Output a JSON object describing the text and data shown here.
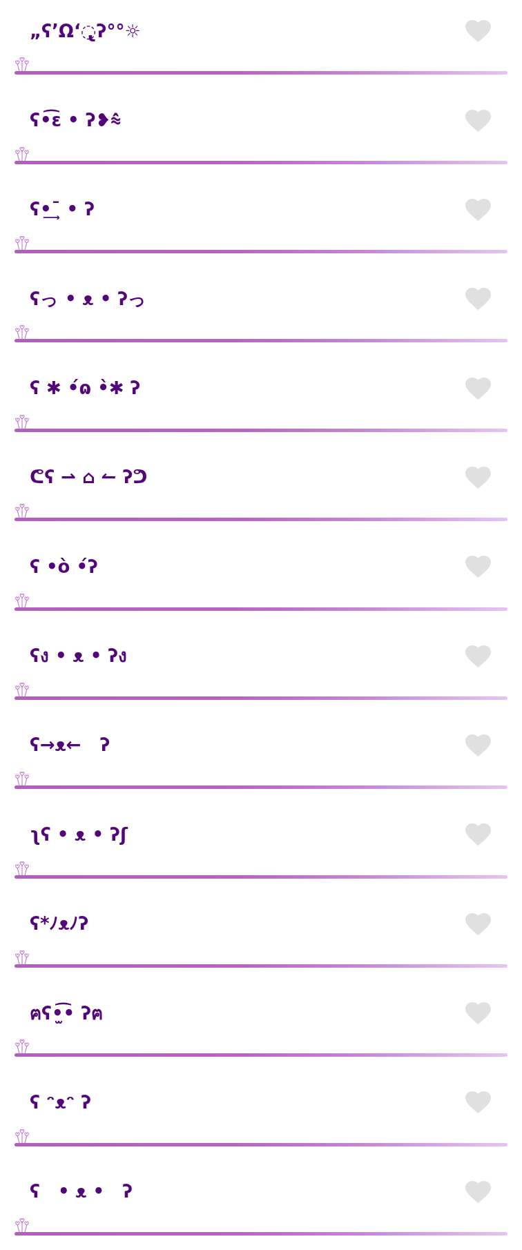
{
  "kaomoji": [
    {
      "text": "„ʕ’Ω‘◌̢ʔ°°☼",
      "favorite": false
    },
    {
      "text": "ʕ•͡ɛ • ʔ❥⩯",
      "favorite": false
    },
    {
      "text": "ʕ•͢¯ • ʔ",
      "favorite": false
    },
    {
      "text": "ʕっ • ᴥ • ʔっ",
      "favorite": false
    },
    {
      "text": "ʕ ✱ •́ɷ •̀✱ ʔ",
      "favorite": false
    },
    {
      "text": "ᕦʕ ⇀ ⌂ ↼ ʔᕤ",
      "favorite": false
    },
    {
      "text": "ʕ •ò •́ʔ",
      "favorite": false
    },
    {
      "text": "ʕง • ᴥ • ʔง",
      "favorite": false
    },
    {
      "text": "ʕ→ᴥ←   ʔ",
      "favorite": false
    },
    {
      "text": "ʅʕ • ᴥ • ʔʃ",
      "favorite": false
    },
    {
      "text": "ʕ*ﾉᴥﾉʔ",
      "favorite": false
    },
    {
      "text": "ฅʕ•̫͡• ʔฅ",
      "favorite": false
    },
    {
      "text": "ʕ ᵔᴥᵔ ʔ",
      "favorite": false
    },
    {
      "text": "ʕ　• ᴥ •　ʔ",
      "favorite": false
    }
  ]
}
